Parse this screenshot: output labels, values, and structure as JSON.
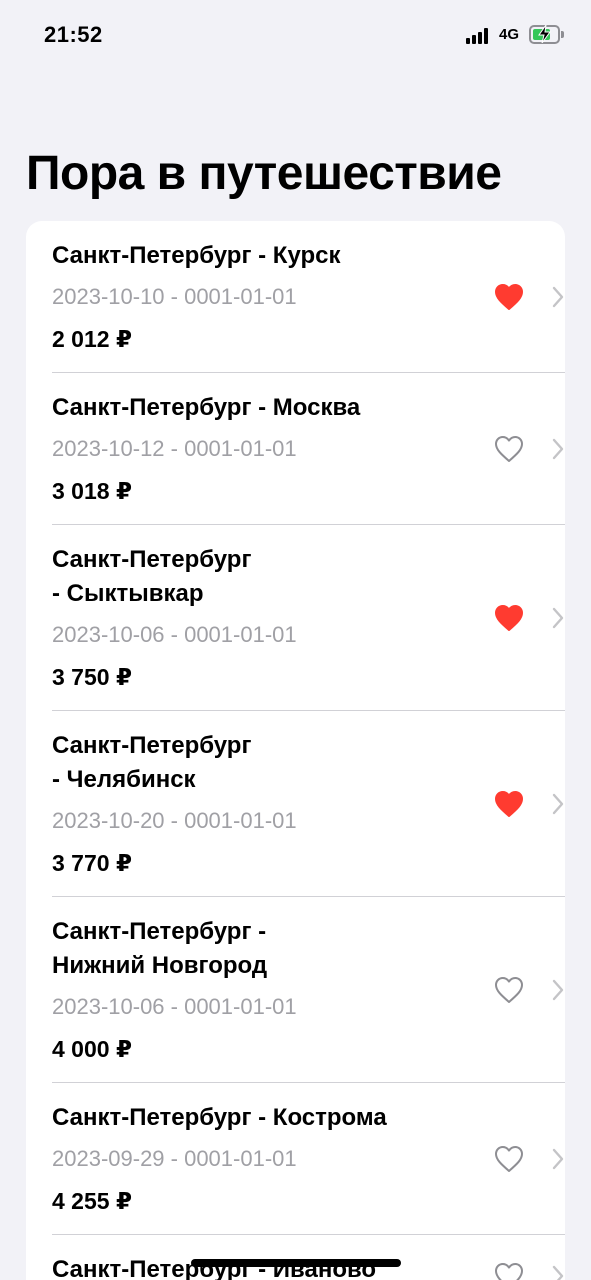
{
  "status_bar": {
    "time": "21:52",
    "network": "4G",
    "battery_charging": true
  },
  "page_title": "Пора в путешествие",
  "colors": {
    "heart_filled": "#ff3b30",
    "heart_outline": "#8e8e93",
    "secondary_text": "#a0a0a5",
    "background": "#f2f2f7"
  },
  "trips": [
    {
      "route": "Санкт-Петербург - Курск",
      "dates": "2023-10-10 - 0001-01-01",
      "price": "2 012 ₽",
      "favorite": true
    },
    {
      "route": "Санкт-Петербург - Москва",
      "dates": "2023-10-12 - 0001-01-01",
      "price": "3 018 ₽",
      "favorite": false
    },
    {
      "route": "Санкт-Петербург - Сыктывкар",
      "dates": "2023-10-06 - 0001-01-01",
      "price": "3 750 ₽",
      "favorite": true
    },
    {
      "route": "Санкт-Петербург - Челябинск",
      "dates": "2023-10-20 - 0001-01-01",
      "price": "3 770 ₽",
      "favorite": true
    },
    {
      "route": "Санкт-Петербург - Нижний Новгород",
      "dates": "2023-10-06 - 0001-01-01",
      "price": "4 000 ₽",
      "favorite": false
    },
    {
      "route": "Санкт-Петербург - Кострома",
      "dates": "2023-09-29 - 0001-01-01",
      "price": "4 255 ₽",
      "favorite": false
    },
    {
      "route": "Санкт-Петербург - Иваново",
      "dates": "",
      "price": "",
      "favorite": false
    }
  ]
}
